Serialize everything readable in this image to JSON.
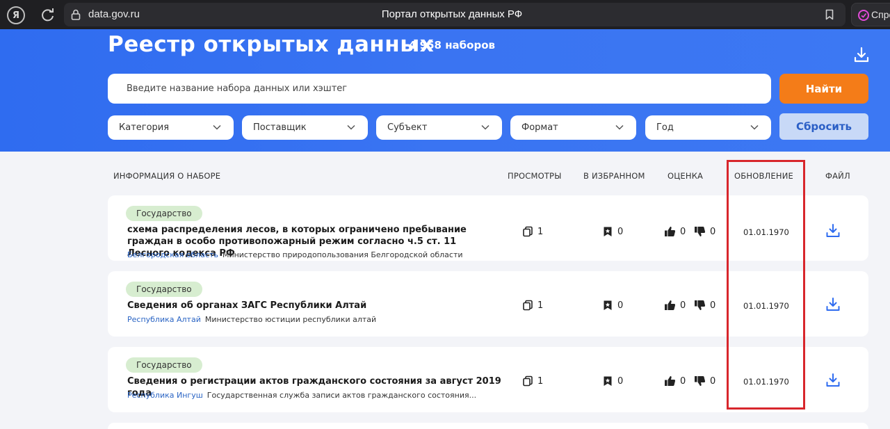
{
  "browser": {
    "logo_letter": "Я",
    "domain": "data.gov.ru",
    "page_title": "Портал открытых данных РФ",
    "extension_label": "Спро"
  },
  "header": {
    "title": "Реестр открытых данных",
    "count": "4 958 наборов",
    "search_placeholder": "Введите название набора данных или хэштег",
    "find_label": "Найти",
    "reset_label": "Сбросить",
    "filters": [
      "Категория",
      "Поставщик",
      "Субъект",
      "Формат",
      "Год"
    ]
  },
  "table": {
    "columns": {
      "info": "ИНФОРМАЦИЯ О НАБОРЕ",
      "views": "ПРОСМОТРЫ",
      "favorites": "В ИЗБРАННОМ",
      "rating": "ОЦЕНКА",
      "updated": "ОБНОВЛЕНИЕ",
      "file": "ФАЙЛ"
    },
    "rows": [
      {
        "tag": "Государство",
        "title": "схема распределения лесов, в которых ограничено пребывание граждан в особо противопожарный режим согласно ч.5 ст. 11 Лесного кодекса РФ",
        "region": "Белгородская область",
        "org": "Министерство природопользования Белгородской области",
        "views": "1",
        "favorites": "0",
        "likes": "0",
        "dislikes": "0",
        "updated": "01.01.1970"
      },
      {
        "tag": "Государство",
        "title": "Сведения об органах ЗАГС Республики Алтай",
        "region": "Республика Алтай",
        "org": "Министерство юстиции республики алтай",
        "views": "1",
        "favorites": "0",
        "likes": "0",
        "dislikes": "0",
        "updated": "01.01.1970"
      },
      {
        "tag": "Государство",
        "title": "Сведения о регистрации актов гражданского состояния за август 2019 года",
        "region": "Республика Ингуш",
        "org": "Государственная служба записи актов гражданского состояния...",
        "views": "1",
        "favorites": "0",
        "likes": "0",
        "dislikes": "0",
        "updated": "01.01.1970"
      }
    ]
  },
  "colors": {
    "brand_blue": "#3a74f2",
    "accent_orange": "#f47c18",
    "tag_green": "#d7edd0",
    "link_blue": "#2a64c4",
    "highlight_red": "#d8262c"
  }
}
